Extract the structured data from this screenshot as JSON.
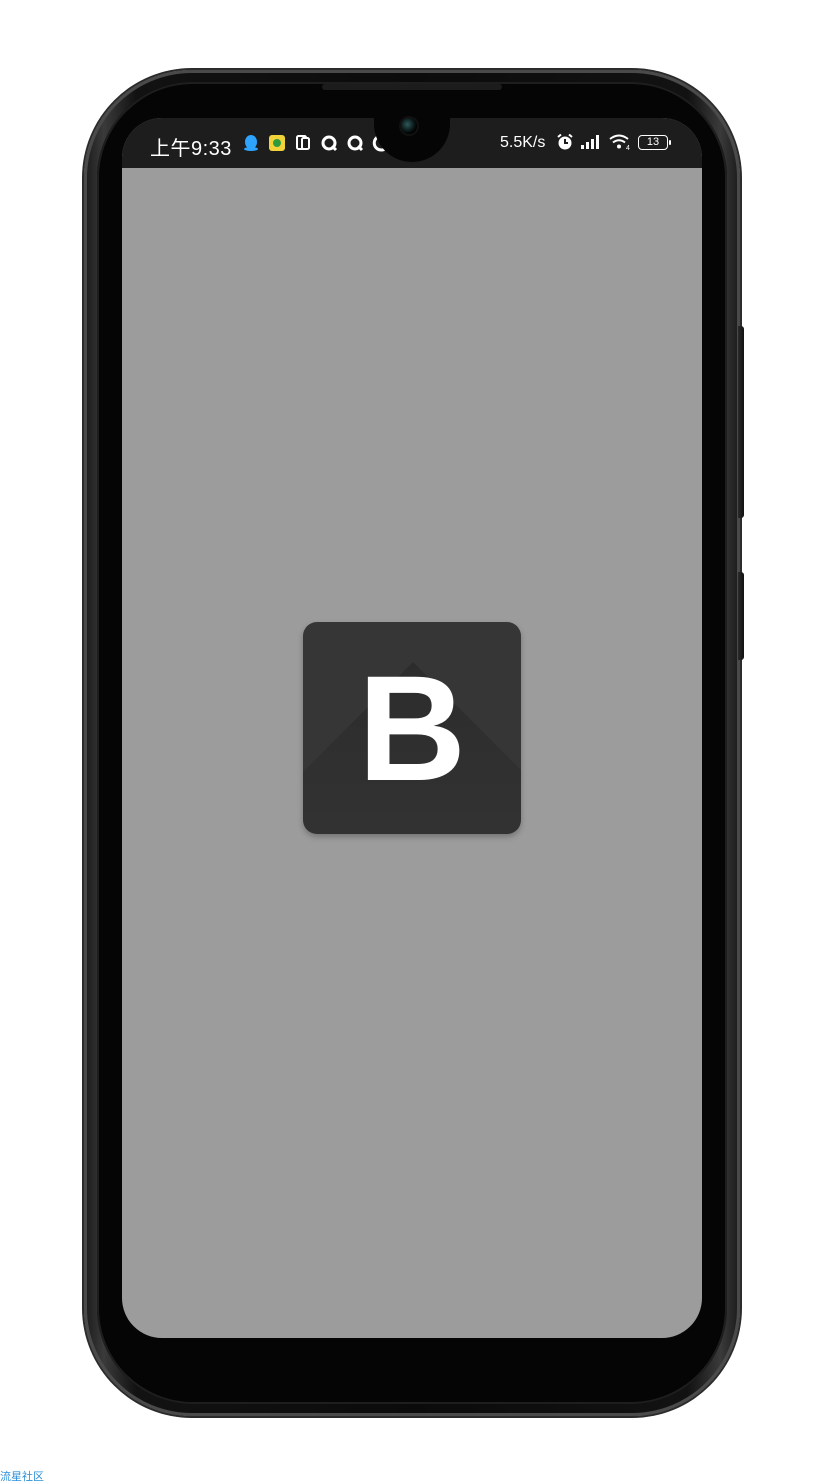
{
  "status_bar": {
    "time": "上午9:33",
    "network_speed": "5.5K/s",
    "battery_level": "13",
    "left_icons": [
      "qq-icon",
      "app-icon",
      "screenshot-icon",
      "q-icon",
      "q-icon",
      "c-icon",
      "s-icon"
    ],
    "right_icons": [
      "alarm-icon",
      "signal-icon",
      "wifi-icon"
    ]
  },
  "splash": {
    "logo_letter": "B",
    "background_color": "#9c9c9c",
    "logo_color": "#363636"
  },
  "watermark": {
    "text": "流星社区"
  }
}
